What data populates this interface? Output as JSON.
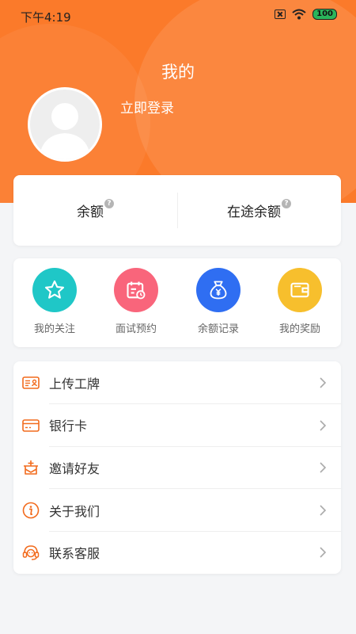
{
  "status_bar": {
    "time": "下午4:19",
    "battery": "100"
  },
  "header": {
    "title": "我的",
    "login_label": "立即登录"
  },
  "balance": {
    "balance_label": "余额",
    "in_transit_label": "在途余额",
    "help_glyph": "?"
  },
  "quick_actions": [
    {
      "label": "我的关注",
      "icon": "star-icon",
      "color": "#1fc7c7"
    },
    {
      "label": "面试预约",
      "icon": "calendar-icon",
      "color": "#f9657b"
    },
    {
      "label": "余额记录",
      "icon": "money-bag-icon",
      "color": "#2f6ef2"
    },
    {
      "label": "我的奖励",
      "icon": "wallet-icon",
      "color": "#f7bf2d"
    }
  ],
  "menu": [
    {
      "label": "上传工牌",
      "icon": "badge-icon"
    },
    {
      "label": "银行卡",
      "icon": "bank-card-icon"
    },
    {
      "label": "邀请好友",
      "icon": "invite-icon"
    },
    {
      "label": "关于我们",
      "icon": "info-icon"
    },
    {
      "label": "联系客服",
      "icon": "headset-icon"
    }
  ],
  "colors": {
    "accent": "#fb7a2a",
    "icon_orange": "#f26b1d"
  }
}
